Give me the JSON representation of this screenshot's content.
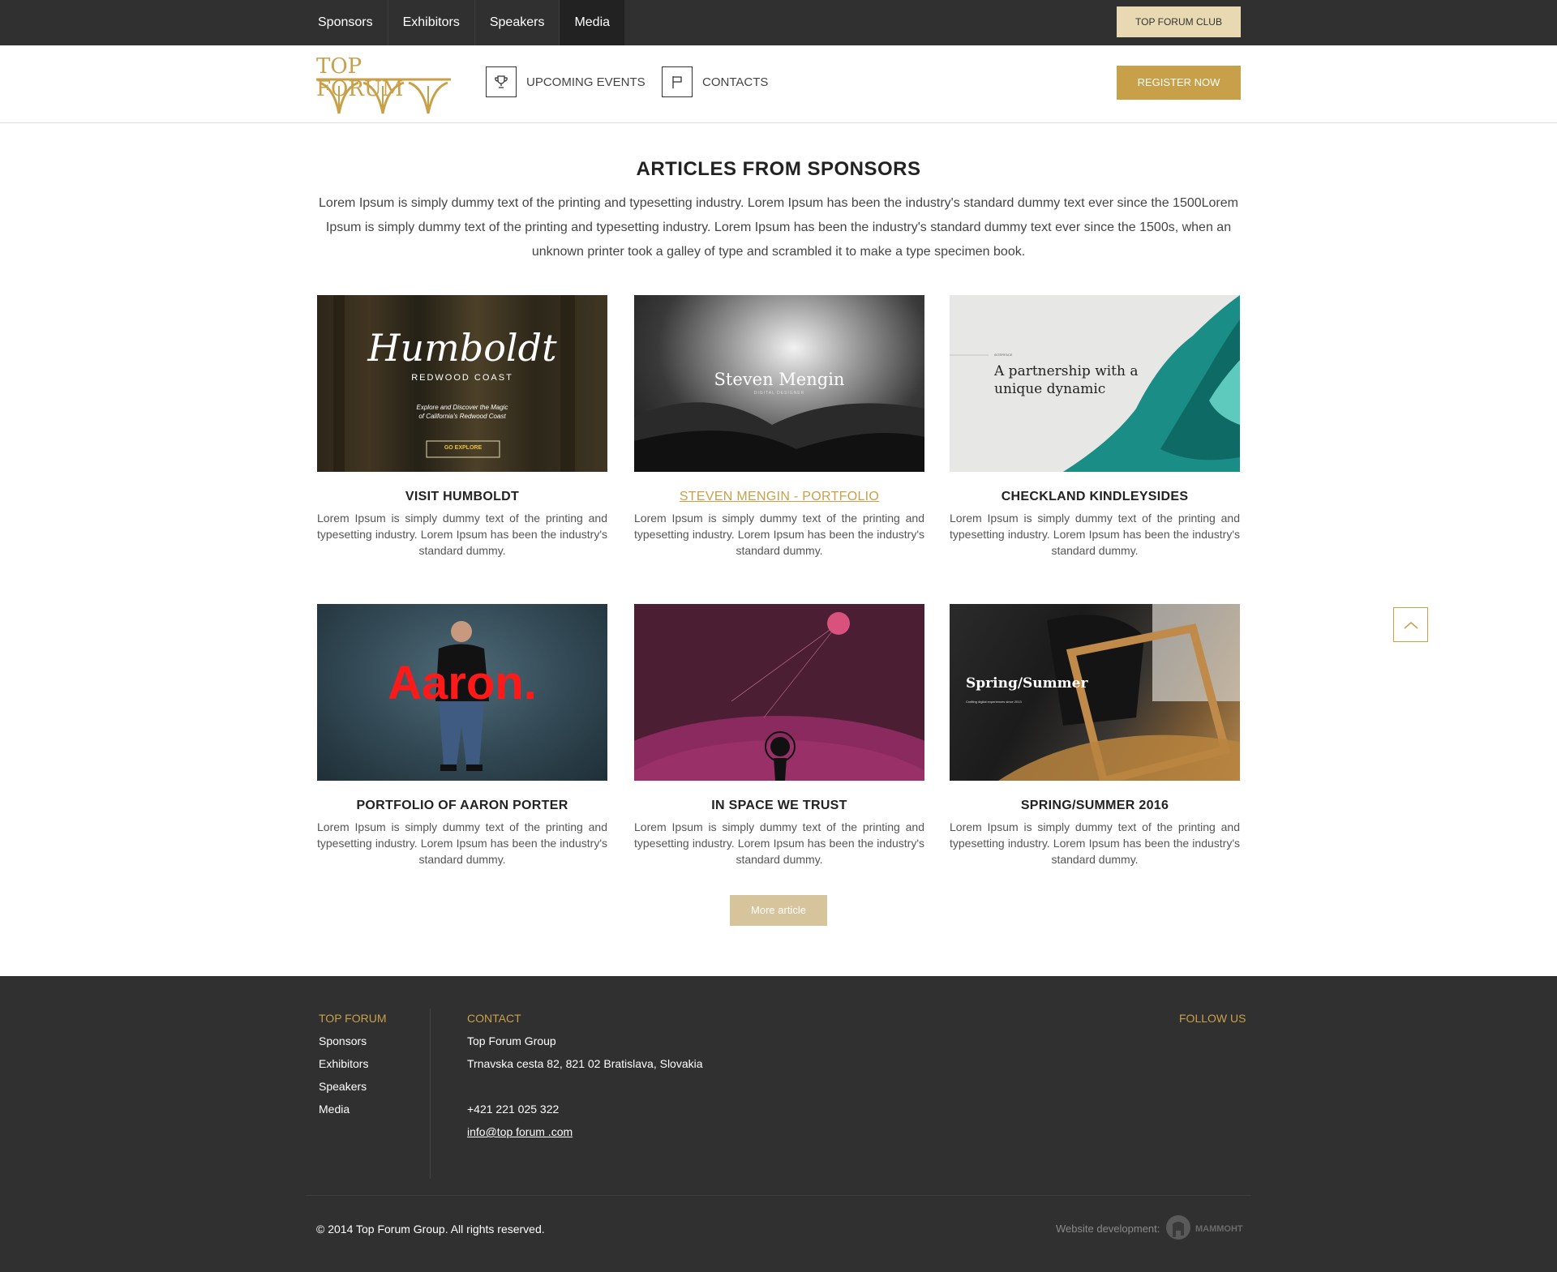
{
  "topbar": {
    "nav": [
      "Sponsors",
      "Exhibitors",
      "Speakers",
      "Media"
    ],
    "club_button": "TOP FORUM CLUB"
  },
  "header": {
    "logo_text": "TOP FORUM",
    "nav": [
      {
        "label": "UPCOMING EVENTS",
        "icon": "trophy-icon"
      },
      {
        "label": "CONTACTS",
        "icon": "flag-icon"
      }
    ],
    "register_button": "REGISTER NOW"
  },
  "section": {
    "title": "ARTICLES FROM SPONSORS",
    "intro": "Lorem Ipsum is simply dummy text of the printing and typesetting industry. Lorem Ipsum has been the industry's standard dummy text ever since the 1500Lorem Ipsum is simply dummy text of the printing and typesetting industry. Lorem Ipsum has been the industry's standard dummy text ever since the 1500s, when an unknown printer took a galley of type and scrambled it to make a type specimen book."
  },
  "articles": [
    {
      "title": "VISIT HUMBOLDT",
      "text": "Lorem Ipsum is simply dummy text of the printing and typesetting industry. Lorem Ipsum has been the industry's standard dummy.",
      "image": {
        "script": "Humboldt",
        "sub": "REDWOOD COAST",
        "tag1": "Explore and Discover the Magic",
        "tag2": "of California's Redwood Coast",
        "cta": "GO EXPLORE"
      }
    },
    {
      "title": "STEVEN MENGIN - PORTFOLIO",
      "text": "Lorem Ipsum is simply dummy text of the printing and typesetting industry. Lorem Ipsum has been the industry's standard dummy.",
      "image": {
        "name": "Steven Mengin",
        "sub": "DIGITAL DESIGNER"
      }
    },
    {
      "title": "CHECKLAND KINDLEYSIDES",
      "text": "Lorem Ipsum is simply dummy text of the printing and typesetting industry. Lorem Ipsum has been the industry's standard dummy.",
      "image": {
        "small": "INTERFACE",
        "line1": "A partnership with a",
        "line2": "unique dynamic"
      }
    },
    {
      "title": "PORTFOLIO OF AARON PORTER",
      "text": "Lorem Ipsum is simply dummy text of the printing and typesetting industry. Lorem Ipsum has been the industry's standard dummy.",
      "image": {
        "word": "Aaron."
      }
    },
    {
      "title": "IN SPACE WE TRUST",
      "text": "Lorem Ipsum is simply dummy text of the printing and typesetting industry. Lorem Ipsum has been the industry's standard dummy.",
      "image": {}
    },
    {
      "title": "SPRING/SUMMER 2016",
      "text": "Lorem Ipsum is simply dummy text of the printing and typesetting industry. Lorem Ipsum has been the industry's standard dummy.",
      "image": {
        "heading": "Spring/Summer",
        "sub": "Crafting digital experiences since 2013"
      }
    }
  ],
  "more_button": "More article",
  "footer": {
    "col1_head": "TOP FORUM",
    "col1_links": [
      "Sponsors",
      "Exhibitors",
      "Speakers",
      "Media"
    ],
    "col2_head": "CONTACT",
    "company": "Top Forum Group",
    "address": "Trnavska cesta 82, 821 02 Bratislava, Slovakia",
    "phone": "+421 221 025 322",
    "email": "info@top forum .com",
    "follow_head": "FOLLOW US",
    "copyright": "© 2014 Top Forum Group. All rights reserved.",
    "dev_label": "Website development:",
    "dev_logo_text": "МАММОНТ"
  },
  "colors": {
    "gold": "#c9a04a",
    "dark": "#303030",
    "light_gold": "#e8d9b3"
  }
}
